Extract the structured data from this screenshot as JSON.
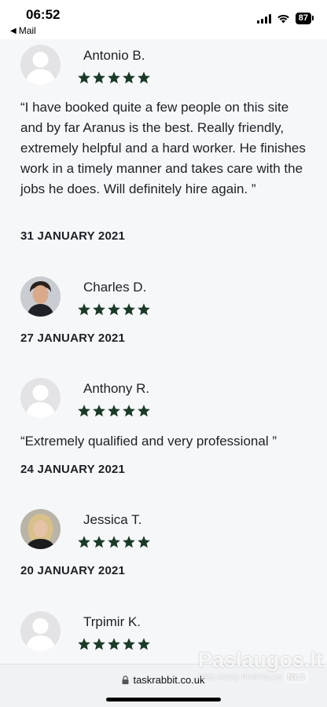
{
  "status_bar": {
    "time": "06:52",
    "back_app": "Mail",
    "battery": "87"
  },
  "colors": {
    "star": "#1b3a27",
    "avatar_placeholder": "#e3e3e5"
  },
  "reviews": [
    {
      "name": "Antonio B.",
      "rating": 5,
      "text": "“I have booked quite a few people on this site and by far Aranus is the best. Really friendly, extremely helpful and a hard worker. He finishes work in a timely manner and takes care with the jobs he does. Will definitely hire again. ”",
      "date": "31 JANUARY 2021",
      "avatar": "placeholder"
    },
    {
      "name": "Charles D.",
      "rating": 5,
      "text": "",
      "date": "27 JANUARY 2021",
      "avatar": "photo"
    },
    {
      "name": "Anthony R.",
      "rating": 5,
      "text": "“Extremely qualified and very professional ”",
      "date": "24 JANUARY 2021",
      "avatar": "placeholder"
    },
    {
      "name": "Jessica T.",
      "rating": 5,
      "text": "",
      "date": "20 JANUARY 2021",
      "avatar": "photo"
    },
    {
      "name": "Trpimir K.",
      "rating": 5,
      "text": "",
      "date": "",
      "avatar": "placeholder"
    }
  ],
  "browser": {
    "url": "taskrabbit.co.uk"
  },
  "watermark": {
    "title": "Paslaugos.lt",
    "subtitle": "PASLAUGŲ PORTALAS",
    "badge": "Nr.1"
  }
}
